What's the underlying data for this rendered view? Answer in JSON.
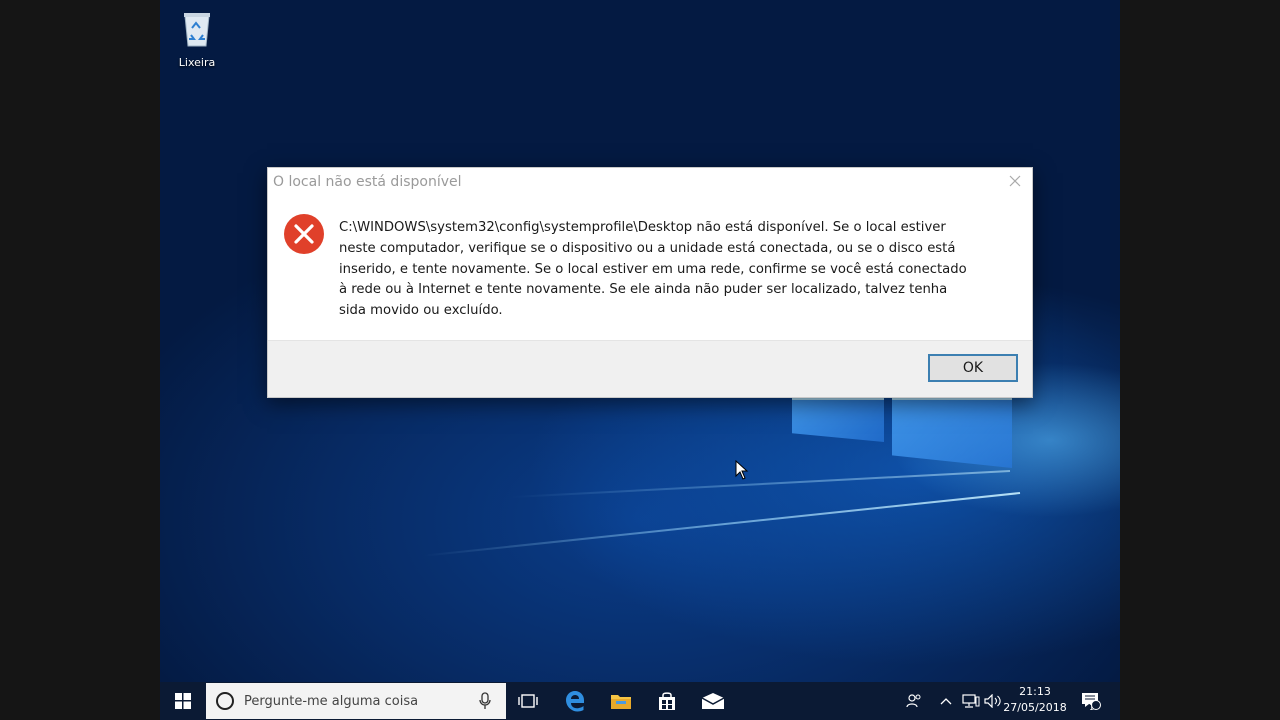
{
  "desktop": {
    "icons": [
      {
        "label": "Lixeira",
        "icon": "recycle-bin-icon"
      }
    ]
  },
  "dialog": {
    "title": "O local não está disponível",
    "icon": "error-icon",
    "message_lines": [
      "C:\\WINDOWS\\system32\\config\\systemprofile\\Desktop não está disponível. Se o local estiver",
      "neste computador, verifique se o dispositivo ou a unidade está conectada, ou se o disco está",
      "inserido, e tente novamente. Se o local estiver em uma rede, confirme se você está conectado",
      "à rede ou à Internet e tente novamente. Se ele ainda não puder ser localizado, talvez tenha",
      "sida movido ou excluído."
    ],
    "ok_label": "OK",
    "colors": {
      "error_red": "#e0402a",
      "button_border": "#3c7fb1"
    }
  },
  "taskbar": {
    "search_placeholder": "Pergunte-me alguma coisa",
    "pinned": [
      "task-view-icon",
      "edge-icon",
      "file-explorer-icon",
      "store-icon",
      "mail-icon"
    ],
    "tray": [
      "people-icon",
      "chevron-up-icon",
      "network-icon",
      "volume-icon"
    ],
    "time": "21:13",
    "date": "27/05/2018",
    "notification_count": "1"
  }
}
